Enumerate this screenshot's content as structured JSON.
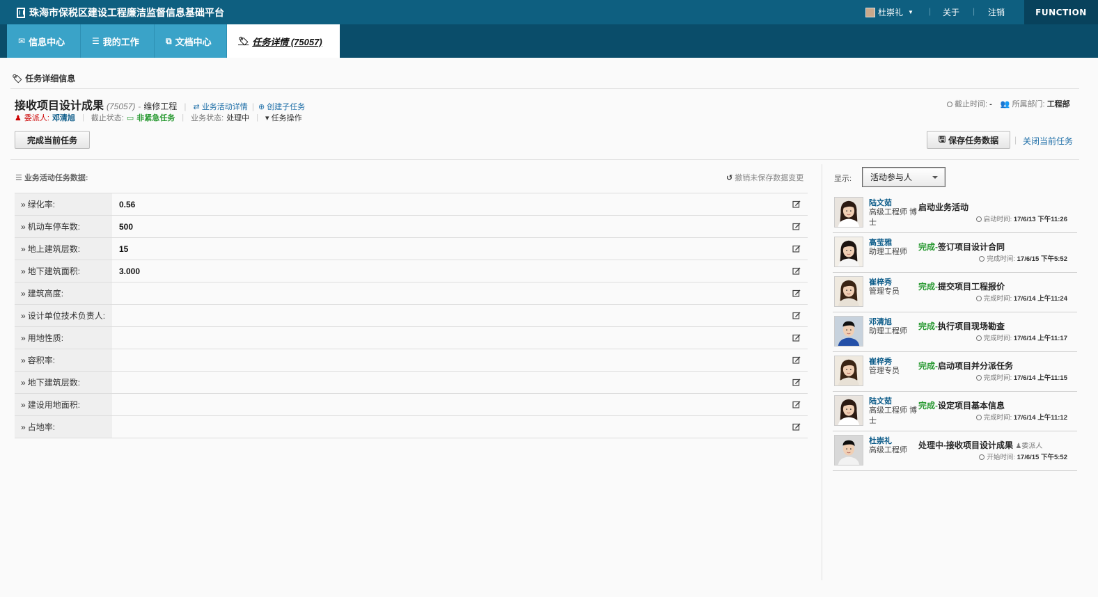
{
  "header": {
    "app_title": "珠海市保税区建设工程廉洁监督信息基础平台",
    "user_name": "杜崇礼",
    "about": "关于",
    "logout": "注销",
    "brand": "FUNCTION"
  },
  "tabs": [
    {
      "label": "信息中心",
      "icon": "envelope-icon"
    },
    {
      "label": "我的工作",
      "icon": "list-icon"
    },
    {
      "label": "文档中心",
      "icon": "copy-icon"
    },
    {
      "label": "任务详情 (75057)",
      "icon": "tag-icon",
      "active": true
    }
  ],
  "section": {
    "title": "任务详细信息"
  },
  "task": {
    "name": "接收项目设计成果",
    "id": "(75057)",
    "dash": "-",
    "type": "维修工程",
    "activity_link": "业务活动详情",
    "subtask_link": "创建子任务",
    "delegate_label": "委派人:",
    "delegate": "邓清旭",
    "deadline_state_label": "截止状态:",
    "deadline_state": "非紧急任务",
    "biz_state_label": "业务状态:",
    "biz_state": "处理中",
    "ops": "任务操作",
    "deadline_label": "截止时间:",
    "deadline": "-",
    "dept_label": "所属部门:",
    "dept": "工程部"
  },
  "buttons": {
    "complete": "完成当前任务",
    "save": "保存任务数据",
    "close": "关闭当前任务"
  },
  "data_panel": {
    "title": "业务活动任务数据:",
    "undo": "撤销未保存数据变更",
    "rows": [
      {
        "label": "绿化率:",
        "value": "0.56"
      },
      {
        "label": "机动车停车数:",
        "value": "500"
      },
      {
        "label": "地上建筑层数:",
        "value": "15"
      },
      {
        "label": "地下建筑面积:",
        "value": "3.000"
      },
      {
        "label": "建筑高度:",
        "value": ""
      },
      {
        "label": "设计单位技术负责人:",
        "value": ""
      },
      {
        "label": "用地性质:",
        "value": ""
      },
      {
        "label": "容积率:",
        "value": ""
      },
      {
        "label": "地下建筑层数:",
        "value": ""
      },
      {
        "label": "建设用地面积:",
        "value": ""
      },
      {
        "label": "占地率:",
        "value": ""
      }
    ]
  },
  "participants_panel": {
    "show_label": "显示:",
    "selected": "活动参与人",
    "items": [
      {
        "name": "陆文茹",
        "role": "高级工程师 博士",
        "status": "",
        "action": "启动业务活动",
        "time_label": "启动时间:",
        "time": "17/6/13 下午11:26",
        "face": "f1"
      },
      {
        "name": "高莹雅",
        "role": "助理工程师",
        "status": "完成-",
        "action": "签订项目设计合同",
        "time_label": "完成时间:",
        "time": "17/6/15 下午5:52",
        "face": "f2"
      },
      {
        "name": "崔梓秀",
        "role": "管理专员",
        "status": "完成-",
        "action": "提交项目工程报价",
        "time_label": "完成时间:",
        "time": "17/6/14 上午11:24",
        "face": "f3"
      },
      {
        "name": "邓清旭",
        "role": "助理工程师",
        "status": "完成-",
        "action": "执行项目现场勘查",
        "time_label": "完成时间:",
        "time": "17/6/14 上午11:17",
        "face": "m1"
      },
      {
        "name": "崔梓秀",
        "role": "管理专员",
        "status": "完成-",
        "action": "启动项目并分派任务",
        "time_label": "完成时间:",
        "time": "17/6/14 上午11:15",
        "face": "f3"
      },
      {
        "name": "陆文茹",
        "role": "高级工程师 博士",
        "status": "完成-",
        "action": "设定项目基本信息",
        "time_label": "完成时间:",
        "time": "17/6/14 上午11:12",
        "face": "f1"
      },
      {
        "name": "杜崇礼",
        "role": "高级工程师",
        "status": "处理中-",
        "action": "接收项目设计成果",
        "tag": "委派人",
        "time_label": "开始时间:",
        "time": "17/6/15 下午5:52",
        "face": "m2"
      }
    ]
  }
}
